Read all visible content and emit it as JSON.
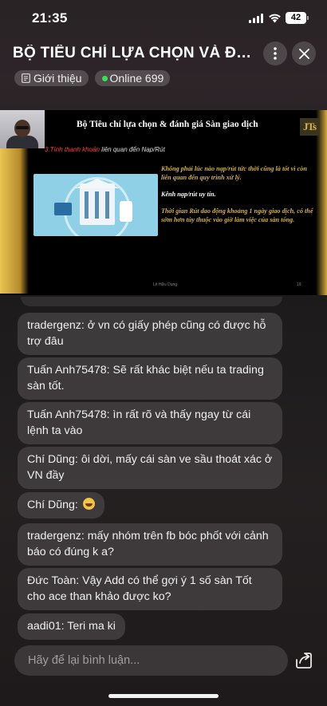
{
  "status_bar": {
    "time": "21:35",
    "battery": "42"
  },
  "header": {
    "title": "BỘ TIÊU CHÍ LỰA CHỌN VÀ ĐÁN...",
    "intro_label": "Giới thiệu",
    "online_label": "Online 699"
  },
  "slide": {
    "title": "Bộ Tiêu chí lựa chọn & đánh giá Sàn giao dịch",
    "logo": "JTs",
    "subtitle_highlight": "3.Tính thanh khoản",
    "subtitle_rest": " liên quan đến Nạp/Rút",
    "para1": "Không phải lúc nào nạp/rút tức thời cũng là tốt vì còn liên quan đến quy trình xử lý.",
    "para2": "Kênh nạp/rút uy tín.",
    "para3": "Thời gian Rút dao động khoảng 1 ngày giao dịch, có thể sớm hơn tùy thuộc vào giờ làm việc của sàn tổng.",
    "footer": "Lê Hữu Dụng",
    "page_number": "19"
  },
  "comments": [
    {
      "text": "tradergenz: ở vn có giấy phép cũng có được hỗ trợ đâu"
    },
    {
      "text": "Tuấn Anh75478: Sẽ rất khác biệt nếu ta trading sàn tốt."
    },
    {
      "text": "Tuấn Anh75478: ìn rất rõ và thấy ngay từ cái lệnh ta vào"
    },
    {
      "text": "Chí Dũng: ôi dời, mấy cái sàn ve sầu thoát xác ở VN đầy"
    },
    {
      "text": "Chí Dũng: "
    },
    {
      "text": "tradergenz: mấy nhóm trên fb bóc phốt với cảnh báo có đúng k a?"
    },
    {
      "text": "Đức Toàn: Vậy Add có thể gợi ý 1 số sàn Tốt cho ace than khảo được ko?"
    },
    {
      "text": "aadi01: Teri ma ki"
    }
  ],
  "input": {
    "placeholder": "Hãy để lại bình luận..."
  },
  "colors": {
    "live": "#3ddc5a",
    "slide_gold": "#d8b047",
    "slide_red": "#ff3b3b"
  },
  "icons": [
    "signal-icon",
    "wifi-icon",
    "more-vertical-icon",
    "close-icon",
    "document-icon",
    "share-icon",
    "laughing-emoji-icon"
  ]
}
